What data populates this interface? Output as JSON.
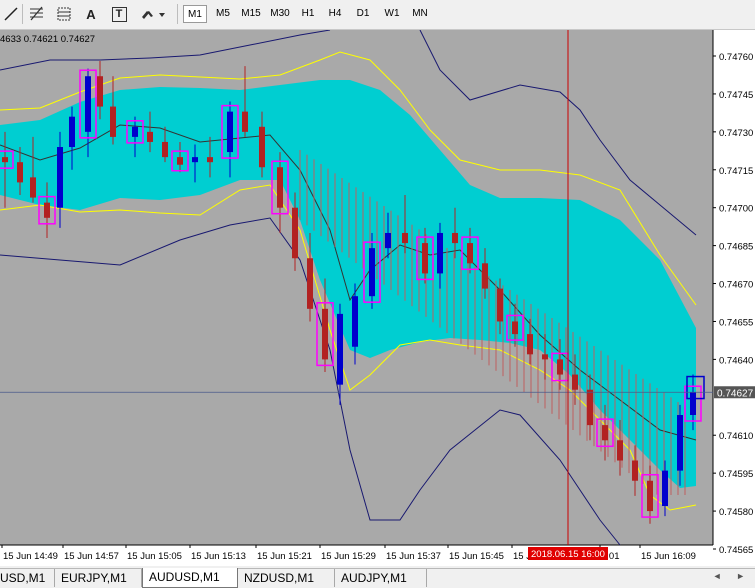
{
  "toolbar": {
    "tools": [
      {
        "name": "trendline-tool-icon"
      },
      {
        "name": "fibonacci-tool-icon"
      },
      {
        "name": "fibonacci-fan-tool-icon"
      },
      {
        "name": "text-tool-icon",
        "glyph": "A"
      },
      {
        "name": "text-label-tool-icon",
        "glyph": "T"
      },
      {
        "name": "arrows-tool-icon"
      }
    ],
    "timeframes": [
      "M1",
      "M5",
      "M15",
      "M30",
      "H1",
      "H4",
      "D1",
      "W1",
      "MN"
    ],
    "active_timeframe": "M1"
  },
  "chart": {
    "ohlc_text": "4633 0.74621 0.74627",
    "price_labels": [
      "0.74760",
      "0.74745",
      "0.74730",
      "0.74715",
      "0.74700",
      "0.74685",
      "0.74670",
      "0.74655",
      "0.74640",
      "0.74610",
      "0.74595",
      "0.74580",
      "0.74565"
    ],
    "current_price": "0.74627",
    "time_labels": [
      "15 Jun 14:49",
      "15 Jun 14:57",
      "15 Jun 15:05",
      "15 Jun 15:13",
      "15 Jun 15:21",
      "15 Jun 15:29",
      "15 Jun 15:37",
      "15 Jun 15:45",
      "15 Jun 1",
      "6:01",
      "15 Jun 16:09"
    ],
    "crosshair_time": "2018.06.15 16:00",
    "colors": {
      "background": "#a9a9a9",
      "cloud": "#00ced1",
      "bull_candle": "#0000cd",
      "bear_candle": "#b22222",
      "ha_box": "#ff00ff",
      "envelope": "#ffff00",
      "outer_band": "#191970",
      "crosshair": "#cc0000"
    }
  },
  "tabs": {
    "items": [
      "USD,M1",
      "EURJPY,M1",
      "AUDUSD,M1",
      "NZDUSD,M1",
      "AUDJPY,M1"
    ],
    "active": "AUDUSD,M1",
    "arrows": "◄ ►"
  }
}
